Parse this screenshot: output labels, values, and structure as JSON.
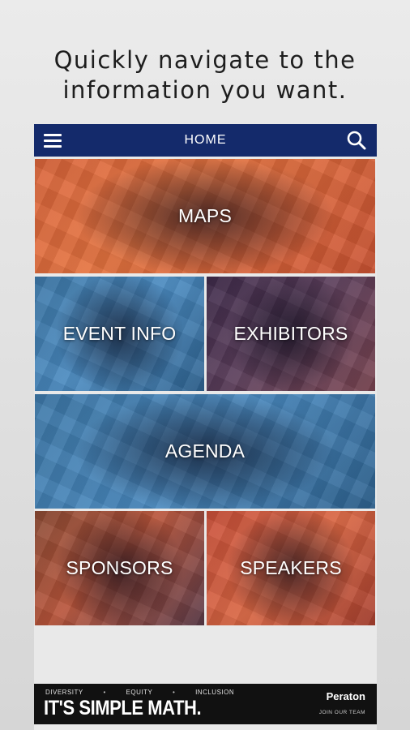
{
  "headline": {
    "line1": "Quickly navigate to the",
    "line2": "information you want."
  },
  "appbar": {
    "title": "HOME",
    "menu_icon": "hamburger-menu-icon",
    "search_icon": "search-icon",
    "background": "#142a6b"
  },
  "tiles": {
    "maps": "MAPS",
    "event_info": "EVENT INFO",
    "exhibitors": "EXHIBITORS",
    "agenda": "AGENDA",
    "sponsors": "SPONSORS",
    "speakers": "SPEAKERS"
  },
  "banner": {
    "tag1": "DIVERSITY",
    "tag2": "EQUITY",
    "tag3": "INCLUSION",
    "separator": "•",
    "slogan": "IT'S SIMPLE MATH.",
    "brand": "Peraton",
    "cta": "JOIN OUR TEAM"
  }
}
